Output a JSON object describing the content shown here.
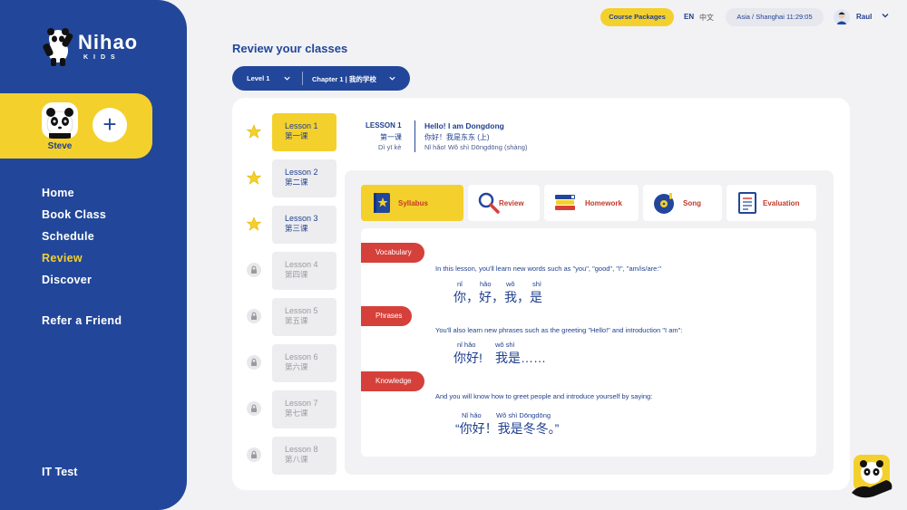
{
  "brand": {
    "name": "Nihao",
    "sub": "KIDS"
  },
  "profile": {
    "name": "Steve",
    "add_label": "+"
  },
  "nav": {
    "items": [
      "Home",
      "Book Class",
      "Schedule",
      "Review",
      "Discover"
    ],
    "refer": "Refer a Friend",
    "it_test": "IT Test"
  },
  "topbar": {
    "course_packages": "Course Packages",
    "lang_en": "EN",
    "lang_zh": "中文",
    "timezone": "Asia / Shanghai 11:29:05",
    "user": "Raul"
  },
  "page": {
    "title": "Review your classes"
  },
  "filters": {
    "level": "Level 1",
    "chapter": "Chapter 1 | 我的学校"
  },
  "lessons": [
    {
      "en": "Lesson 1",
      "zh": "第一课",
      "status": "completed"
    },
    {
      "en": "Lesson 2",
      "zh": "第二课",
      "status": "completed"
    },
    {
      "en": "Lesson 3",
      "zh": "第三课",
      "status": "completed"
    },
    {
      "en": "Lesson 4",
      "zh": "第四课",
      "status": "locked"
    },
    {
      "en": "Lesson 5",
      "zh": "第五课",
      "status": "locked"
    },
    {
      "en": "Lesson 6",
      "zh": "第六课",
      "status": "locked"
    },
    {
      "en": "Lesson 7",
      "zh": "第七课",
      "status": "locked"
    },
    {
      "en": "Lesson 8",
      "zh": "第八课",
      "status": "locked"
    }
  ],
  "lesson_header": {
    "label": "LESSON 1",
    "label_zh": "第一课",
    "label_pinyin": "Dì yī kè",
    "title": "Hello! I am Dongdong",
    "title_zh": "你好！我是东东 (上)",
    "title_pinyin": "Nǐ hǎo! Wǒ shì Dōngdōng (shàng)"
  },
  "tabs": [
    "Syllabus",
    "Review",
    "Homework",
    "Song",
    "Evaluation"
  ],
  "syllabus": {
    "vocabulary": {
      "tag": "Vocabulary",
      "desc": "In this lesson, you'll learn new words such as \"you\", \"good\", \"I\", \"am/is/are:\"",
      "pinyin": [
        "nǐ",
        "hǎo",
        "wǒ",
        "shì"
      ],
      "hanzi": [
        "你，",
        "好，",
        "我，",
        "是"
      ]
    },
    "phrases": {
      "tag": "Phrases",
      "desc": "You'll also learn new phrases such as the greeting \"Hello!\" and introduction \"I am\":",
      "pinyin": [
        "nǐ hǎo",
        "wǒ shì"
      ],
      "hanzi": [
        "你好!",
        "我是……"
      ]
    },
    "knowledge": {
      "tag": "Knowledge",
      "desc": "And you will know how to greet people and introduce yourself by saying:",
      "pinyin": [
        "Nǐ hǎo",
        "Wǒ shì Dōngdōng"
      ],
      "hanzi": "“你好！我是冬冬。”"
    }
  },
  "colors": {
    "primary": "#22479a",
    "accent": "#f4d02c",
    "tag": "#d6403a"
  }
}
